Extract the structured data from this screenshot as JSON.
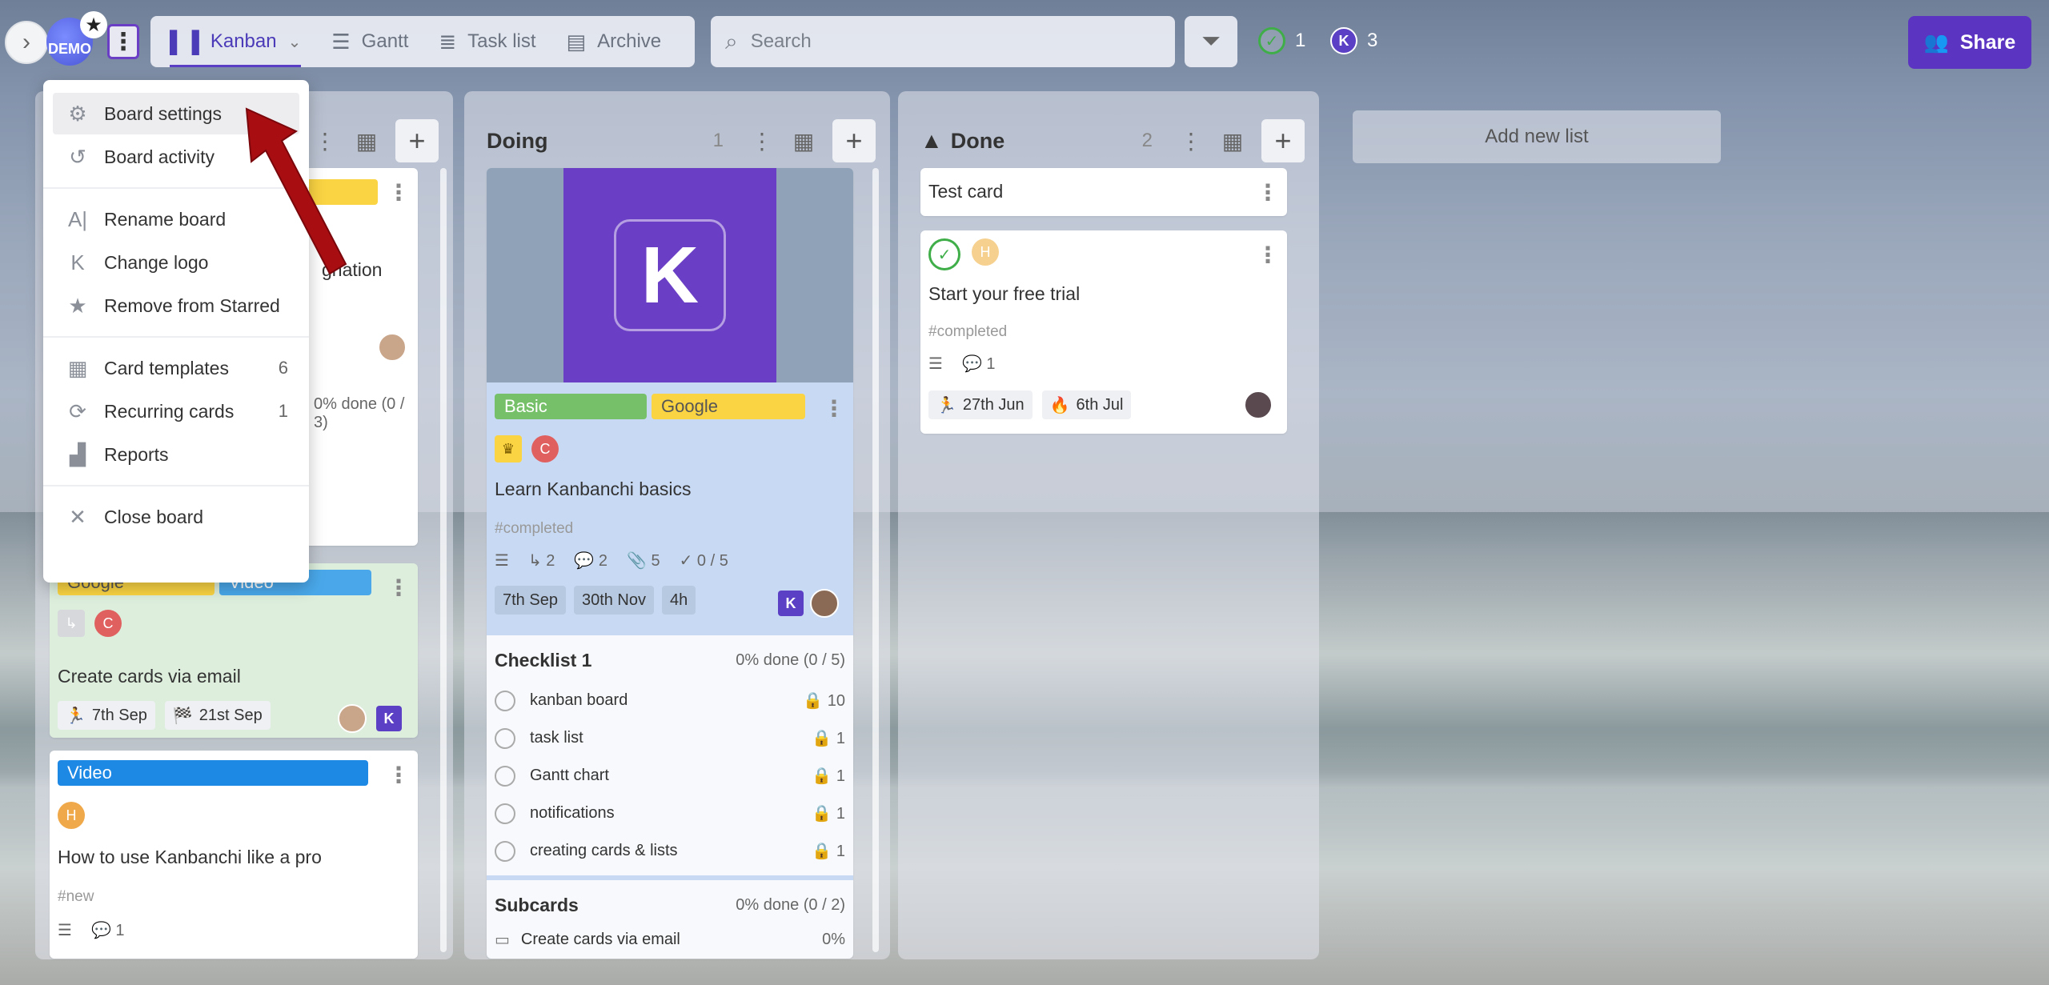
{
  "topbar": {
    "logo_text": "DEMO",
    "tabs": [
      {
        "label": "Kanban",
        "icon": "kanban-icon",
        "active": true
      },
      {
        "label": "Gantt",
        "icon": "gantt-icon"
      },
      {
        "label": "Task list",
        "icon": "list-icon"
      },
      {
        "label": "Archive",
        "icon": "archive-icon"
      }
    ],
    "search_placeholder": "Search",
    "done_count": "1",
    "member_initial": "K",
    "member_count": "3",
    "share_label": "Share"
  },
  "menu": {
    "items": [
      {
        "label": "Board settings",
        "icon": "gear-icon"
      },
      {
        "label": "Board activity",
        "icon": "history-icon"
      },
      {
        "label": "Rename board",
        "icon": "rename-icon"
      },
      {
        "label": "Change logo",
        "icon": "logo-icon"
      },
      {
        "label": "Remove from Starred",
        "icon": "star-icon"
      },
      {
        "label": "Card templates",
        "icon": "templates-icon",
        "count": "6"
      },
      {
        "label": "Recurring cards",
        "icon": "recurring-icon",
        "count": "1"
      },
      {
        "label": "Reports",
        "icon": "reports-icon"
      },
      {
        "label": "Close board",
        "icon": "close-icon"
      }
    ]
  },
  "list1": {
    "card1_partial": "gnation",
    "card1_done": "0% done (0 / 3)",
    "card2": {
      "labels": [
        "Google",
        "Video"
      ],
      "title": "Create cards via email",
      "date1": "7th Sep",
      "date2": "21st Sep",
      "avatar": "K"
    },
    "card3": {
      "label": "Video",
      "badge": "H",
      "title": "How to use Kanbanchi like a pro",
      "tag": "#new",
      "comments": "1"
    }
  },
  "doing": {
    "title": "Doing",
    "count": "1",
    "cover_letter": "K",
    "labels": [
      "Basic",
      "Google"
    ],
    "badge": "C",
    "card_title": "Learn Kanbanchi basics",
    "tag": "#completed",
    "subcards": "2",
    "comments": "2",
    "attachments": "5",
    "checks": "0 / 5",
    "chips": [
      "7th Sep",
      "30th Nov",
      "4h"
    ],
    "avatar": "K",
    "checklist": {
      "title": "Checklist 1",
      "done": "0% done (0 / 5)",
      "items": [
        {
          "text": "kanban board",
          "num": "10"
        },
        {
          "text": "task list",
          "num": "1"
        },
        {
          "text": "Gantt chart",
          "num": "1"
        },
        {
          "text": "notifications",
          "num": "1"
        },
        {
          "text": "creating cards & lists",
          "num": "1"
        }
      ]
    },
    "subcards_block": {
      "title": "Subcards",
      "done": "0% done (0 / 2)",
      "first": "Create cards via email",
      "first_pct": "0%"
    }
  },
  "done": {
    "title": "Done",
    "count": "2",
    "card1_title": "Test card",
    "card2": {
      "badge": "H",
      "title": "Start your free trial",
      "tag": "#completed",
      "comments": "1",
      "date1": "27th Jun",
      "date2": "6th Jul"
    }
  },
  "add_list_label": "Add new list",
  "colors": {
    "accent": "#5b34c2",
    "green": "#3fae49",
    "yellow": "#fad443",
    "blue": "#1e88e5"
  }
}
